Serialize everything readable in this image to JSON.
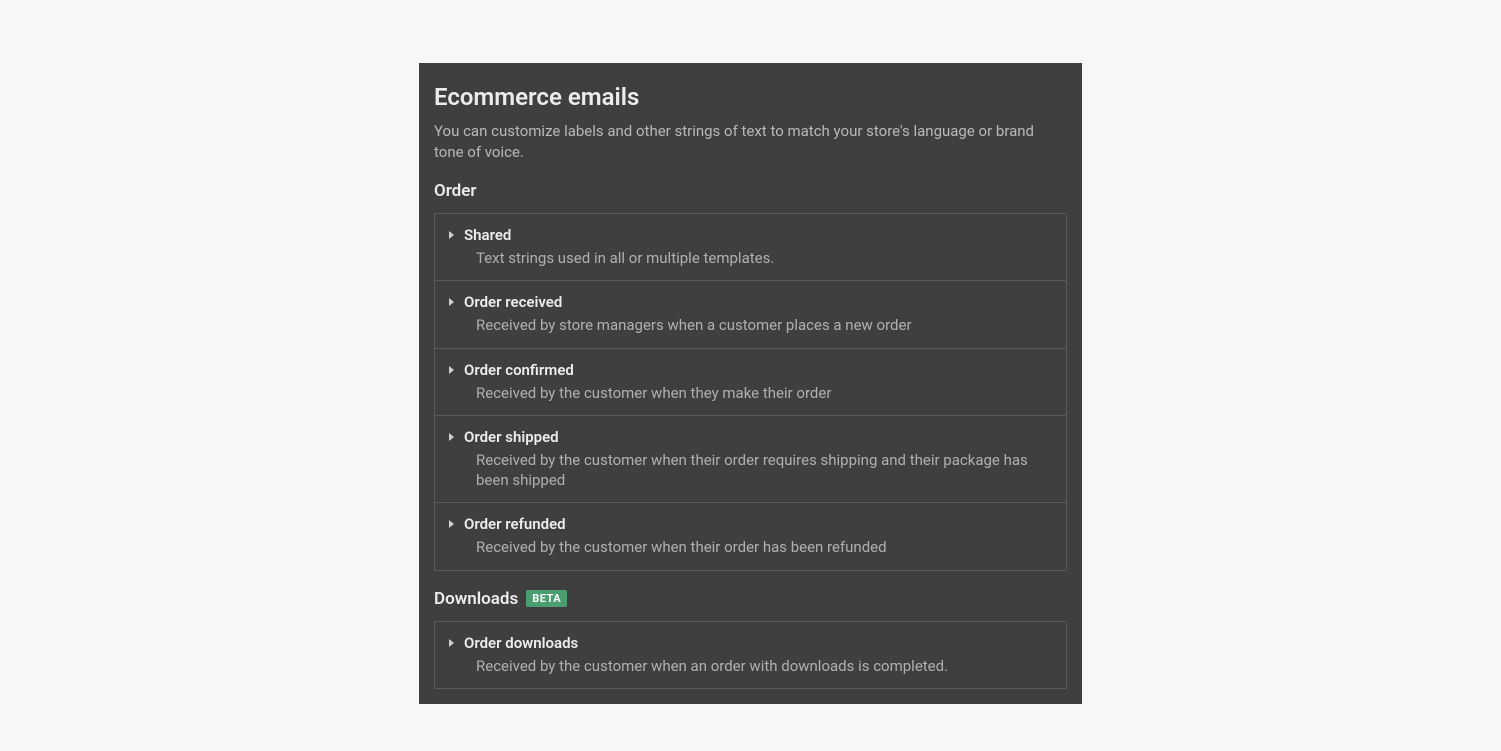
{
  "panel": {
    "title": "Ecommerce emails",
    "description": "You can customize labels and other strings of text to match your store's language or brand tone of voice."
  },
  "sections": {
    "order": {
      "heading": "Order",
      "items": [
        {
          "title": "Shared",
          "desc": "Text strings used in all or multiple templates."
        },
        {
          "title": "Order received",
          "desc": "Received by store managers when a customer places a new order"
        },
        {
          "title": "Order confirmed",
          "desc": "Received by the customer when they make their order"
        },
        {
          "title": "Order shipped",
          "desc": "Received by the customer when their order requires shipping and their package has been shipped"
        },
        {
          "title": "Order refunded",
          "desc": "Received by the customer when their order has been refunded"
        }
      ]
    },
    "downloads": {
      "heading": "Downloads",
      "badge": "BETA",
      "items": [
        {
          "title": "Order downloads",
          "desc": "Received by the customer when an order with downloads is completed."
        }
      ]
    }
  }
}
